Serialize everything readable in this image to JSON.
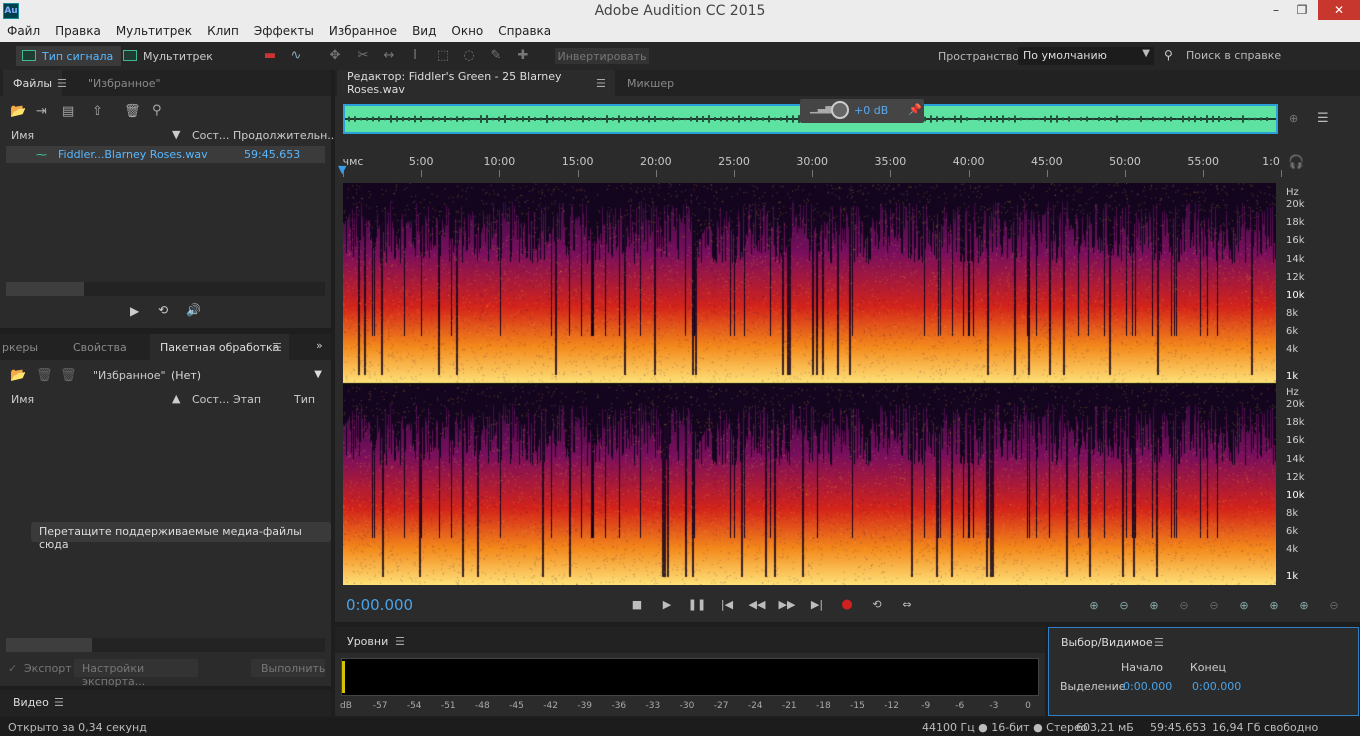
{
  "window": {
    "title": "Adobe Audition CC 2015",
    "app_icon": "Au",
    "minimize": "–",
    "restore": "❐",
    "close": "✕"
  },
  "menu": [
    "Файл",
    "Правка",
    "Мультитрек",
    "Клип",
    "Эффекты",
    "Избранное",
    "Вид",
    "Окно",
    "Справка"
  ],
  "toolbar": {
    "waveform_mode": "Тип сигнала",
    "multitrack_mode": "Мультитрек",
    "invert": "Инвертировать",
    "workspace_label": "Пространство:",
    "workspace_value": "По умолчанию",
    "help_search": "Поиск в справке"
  },
  "files_panel": {
    "tabs": [
      "Файлы",
      "\"Избранное\""
    ],
    "columns": [
      "Имя",
      "Сост...",
      "Продолжительн..."
    ],
    "files": [
      {
        "name": "Fiddler...Blarney Roses.wav",
        "duration": "59:45.653"
      }
    ]
  },
  "batch_panel": {
    "tabs": [
      "ркеры",
      "Свойства",
      "Пакетная обработка"
    ],
    "favorites_label": "\"Избранное\":",
    "favorites_value": "(Нет)",
    "columns": [
      "Имя",
      "Сост...",
      "Этап",
      "Тип"
    ],
    "drop_hint": "Перетащите поддерживаемые медиа-файлы сюда",
    "export_label": "Экспорт",
    "export_settings": "Настройки экспорта...",
    "run": "Выполнить"
  },
  "video_panel": {
    "title": "Видео"
  },
  "editor": {
    "tab_label": "Редактор: Fiddler's Green - 25 Blarney Roses.wav",
    "mixer_tab": "Микшер",
    "volume": "+0 dB",
    "timeline_ticks": [
      "чмс",
      "5:00",
      "10:00",
      "15:00",
      "20:00",
      "25:00",
      "30:00",
      "35:00",
      "40:00",
      "45:00",
      "50:00",
      "55:00",
      "1:0"
    ],
    "freq_labels": [
      "Hz",
      "20k",
      "18k",
      "16k",
      "14k",
      "12k",
      "10k",
      "8k",
      "6k",
      "4k",
      "1k"
    ],
    "current_time": "0:00.000"
  },
  "levels": {
    "title": "Уровни",
    "db_ticks": [
      "dB",
      "-57",
      "-54",
      "-51",
      "-48",
      "-45",
      "-42",
      "-39",
      "-36",
      "-33",
      "-30",
      "-27",
      "-24",
      "-21",
      "-18",
      "-15",
      "-12",
      "-9",
      "-6",
      "-3",
      "0"
    ]
  },
  "selection": {
    "title": "Выбор/Видимое",
    "start_header": "Начало",
    "end_header": "Конец",
    "row_label": "Выделение",
    "start": "0:00.000",
    "end": "0:00.000"
  },
  "status": {
    "opened": "Открыто за 0,34 секунд",
    "format": "44100 Гц ● 16-бит ● Стерео",
    "size": "603,21 мБ",
    "duration": "59:45.653",
    "free": "16,94 Гб свободно"
  },
  "colors": {
    "accent": "#4aa3e8",
    "waveform_overview": "#5ee2a2",
    "record": "#d02020"
  }
}
